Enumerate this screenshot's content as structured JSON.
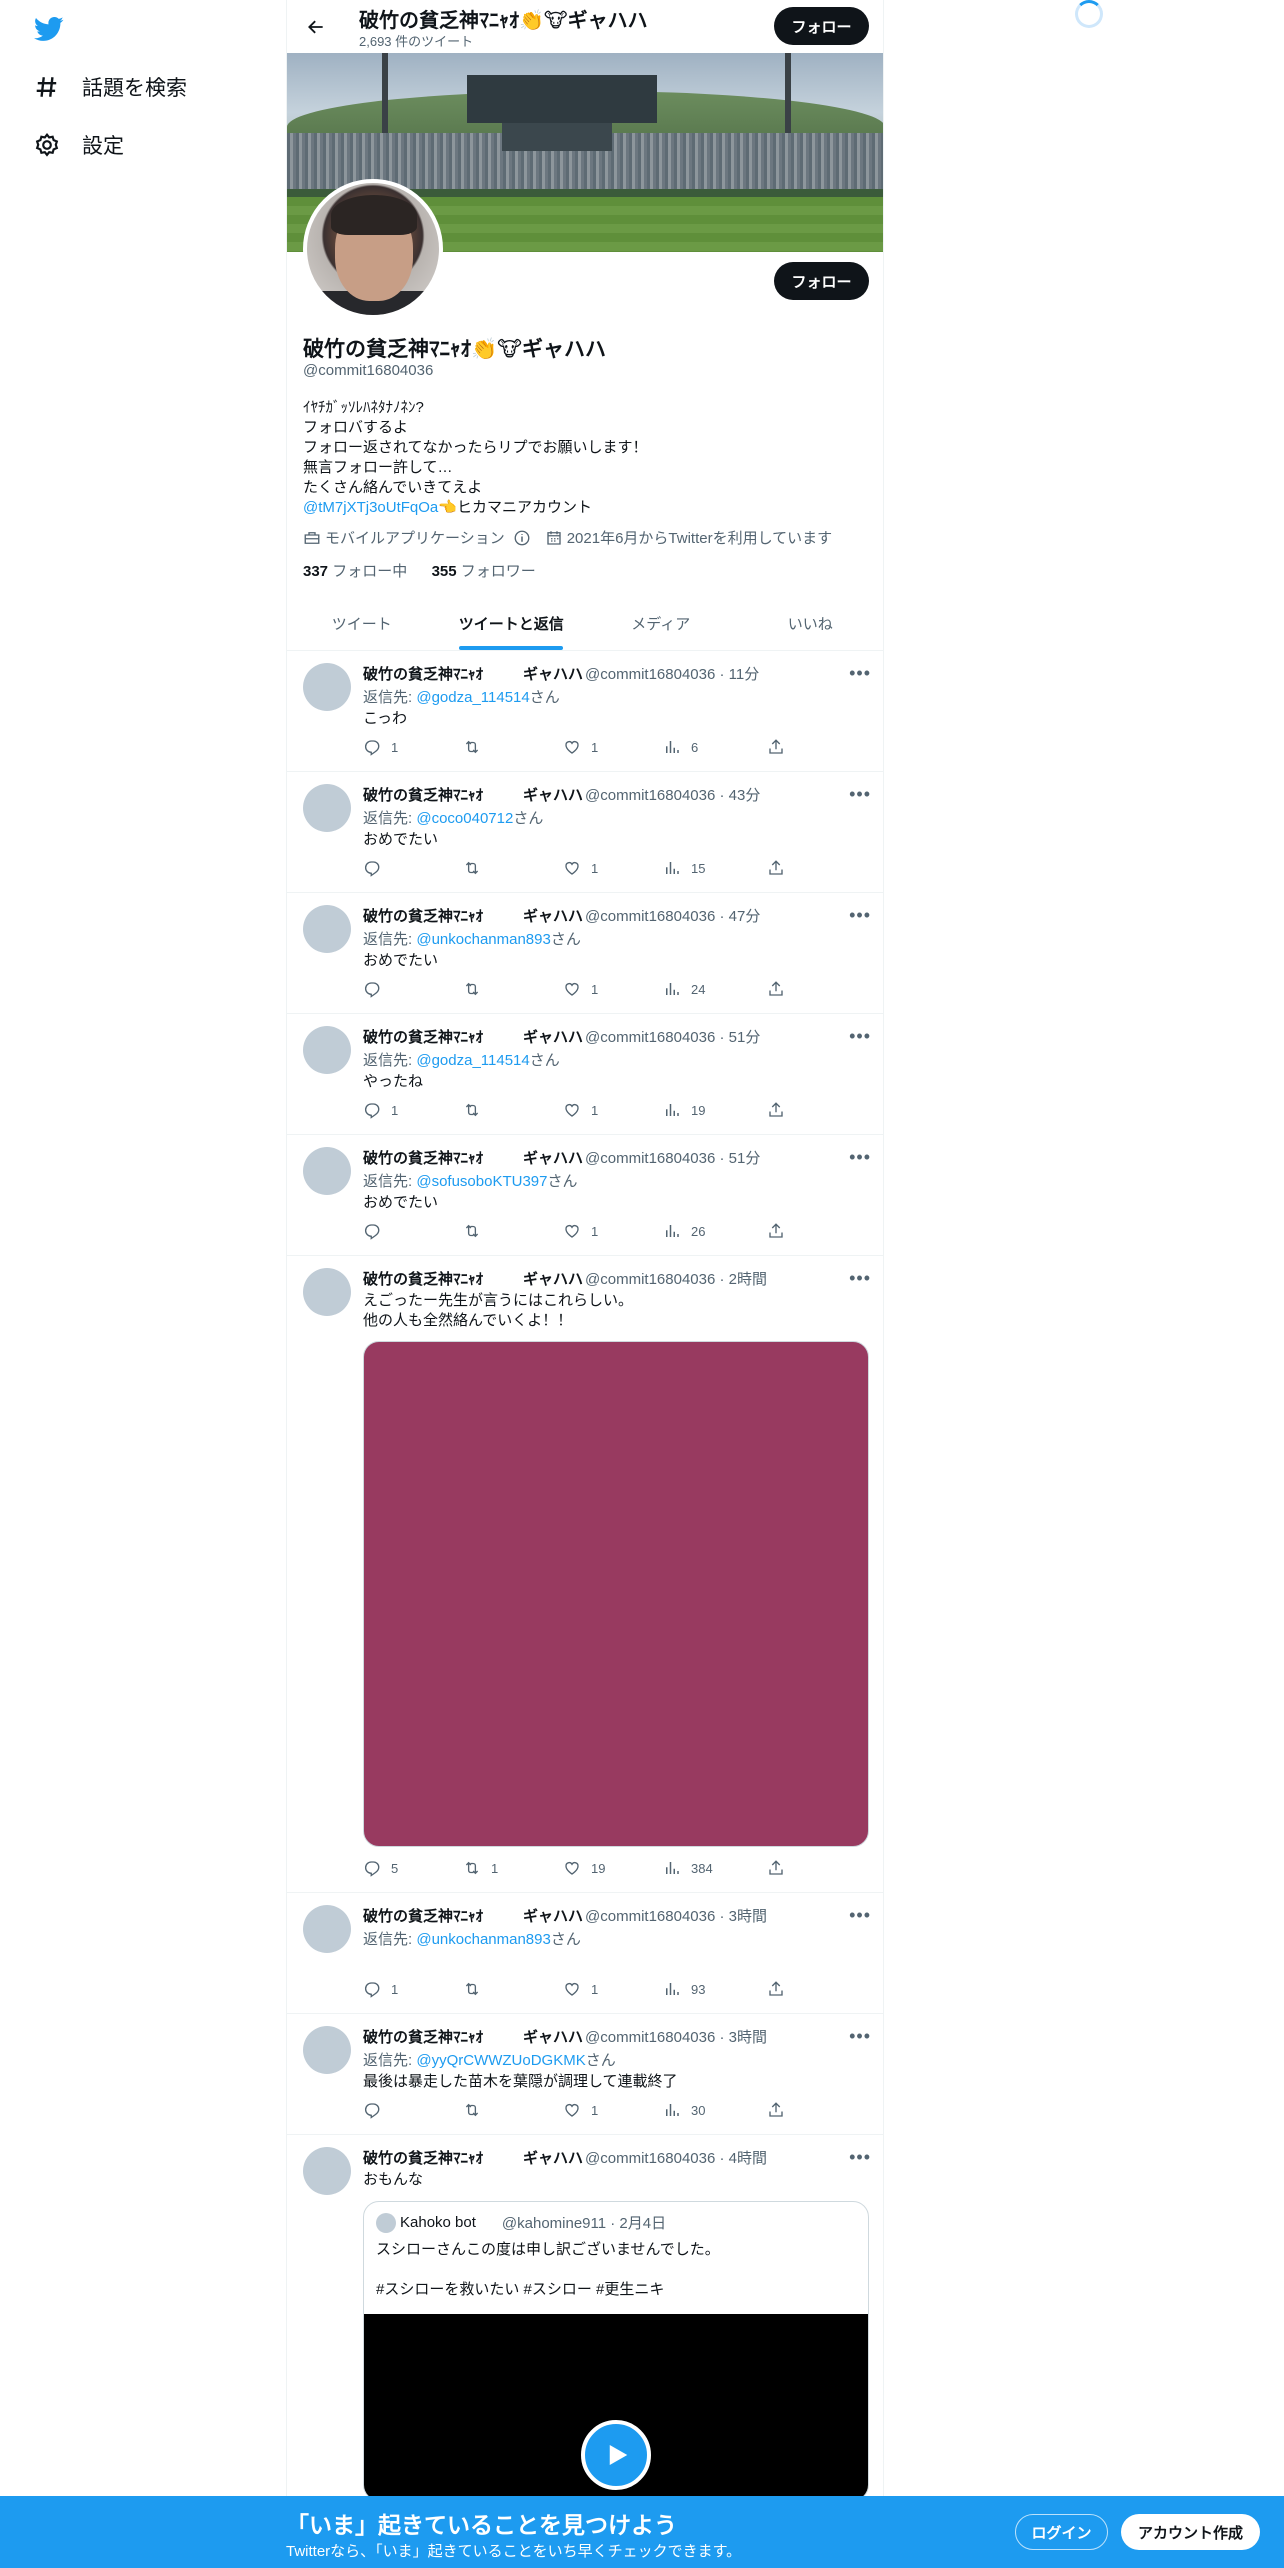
{
  "nav": {
    "items": [
      {
        "label": "話題を検索",
        "icon": "hashtag-icon"
      },
      {
        "label": "設定",
        "icon": "gear-icon"
      }
    ]
  },
  "header": {
    "name": "破竹の貧乏神ﾏﾆｬｵ👏🐮ギャハハ",
    "tweet_count": "2,693 件のツイート",
    "follow_label": "フォロー"
  },
  "profile": {
    "name": "破竹の貧乏神ﾏﾆｬｵ👏🐮ギャハハ",
    "handle": "@commit16804036",
    "follow_label": "フォロー",
    "bio_lines": [
      "ｲﾔﾁｶﾞｯｿﾚﾊﾈﾀﾅﾉﾈﾝ?",
      "フォロバするよ",
      "フォロー返されてなかったらリプでお願いします！",
      "無言フォロー許して…",
      "たくさん絡んでいきてえよ"
    ],
    "bio_link": "@tM7jXTj3oUtFqOa",
    "bio_link_suffix": "👈ヒカマニアカウント",
    "category": "モバイルアプリケーション",
    "joined": "2021年6月からTwitterを利用しています",
    "following_count": "337",
    "following_label": "フォロー中",
    "followers_count": "355",
    "followers_label": "フォロワー"
  },
  "tabs": [
    "ツイート",
    "ツイートと返信",
    "メディア",
    "いいね"
  ],
  "active_tab": "ツイートと返信",
  "tweet_author": "破竹の貧乏神ﾏﾆｬｵ",
  "tweet_author_tail": "ギャハハ",
  "tweets": [
    {
      "meta": "@commit16804036 · 11分",
      "reply_prefix": "返信先: ",
      "reply_to": "@godza_114514",
      "reply_suffix": "さん",
      "text": "こっわ",
      "replies": "1",
      "retweets": "",
      "likes": "1",
      "views": "6"
    },
    {
      "meta": "@commit16804036 · 43分",
      "reply_prefix": "返信先: ",
      "reply_to": "@coco040712",
      "reply_suffix": "さん",
      "text": "おめでたい",
      "replies": "",
      "retweets": "",
      "likes": "1",
      "views": "15"
    },
    {
      "meta": "@commit16804036 · 47分",
      "reply_prefix": "返信先: ",
      "reply_to": "@unkochanman893",
      "reply_suffix": "さん",
      "text": "おめでたい",
      "replies": "",
      "retweets": "",
      "likes": "1",
      "views": "24"
    },
    {
      "meta": "@commit16804036 · 51分",
      "reply_prefix": "返信先: ",
      "reply_to": "@godza_114514",
      "reply_suffix": "さん",
      "text": "やったね",
      "replies": "1",
      "retweets": "",
      "likes": "1",
      "views": "19"
    },
    {
      "meta": "@commit16804036 · 51分",
      "reply_prefix": "返信先: ",
      "reply_to": "@sofusoboKTU397",
      "reply_suffix": "さん",
      "text": "おめでたい",
      "replies": "",
      "retweets": "",
      "likes": "1",
      "views": "26"
    },
    {
      "meta": "@commit16804036 · 2時間",
      "text": "えごったー先生が言うにはこれらしい。\n他の人も全然絡んでいくよ！！",
      "replies": "5",
      "retweets": "1",
      "likes": "19",
      "views": "384",
      "media_color": "#983a60"
    },
    {
      "meta": "@commit16804036 · 3時間",
      "reply_prefix": "返信先: ",
      "reply_to": "@unkochanman893",
      "reply_suffix": "さん",
      "text": "",
      "replies": "1",
      "retweets": "",
      "likes": "1",
      "views": "93"
    },
    {
      "meta": "@commit16804036 · 3時間",
      "reply_prefix": "返信先: ",
      "reply_to": "@yyQrCWWZUoDGKMK",
      "reply_suffix": "さん",
      "text": "最後は暴走した苗木を葉隠が調理して連載終了",
      "replies": "",
      "retweets": "",
      "likes": "1",
      "views": "30"
    },
    {
      "meta": "@commit16804036 · 4時間",
      "text": "おもんな",
      "quote": {
        "name": "Kahoko bot",
        "meta": "@kahomine911 · 2月4日",
        "text": "スシローさんこの度は申し訳ございませんでした。\n\n#スシローを救いたい #スシロー #更生ニキ"
      }
    }
  ],
  "bottom_bar": {
    "title": "「いま」起きていることを見つけよう",
    "subtitle": "Twitterなら、「いま」起きていることをいち早くチェックできます。",
    "login": "ログイン",
    "signup": "アカウント作成"
  },
  "colors": {
    "accent": "#1d9bf0",
    "text": "#0f1419",
    "secondary": "#536471",
    "bar": "#1d9bf0"
  }
}
